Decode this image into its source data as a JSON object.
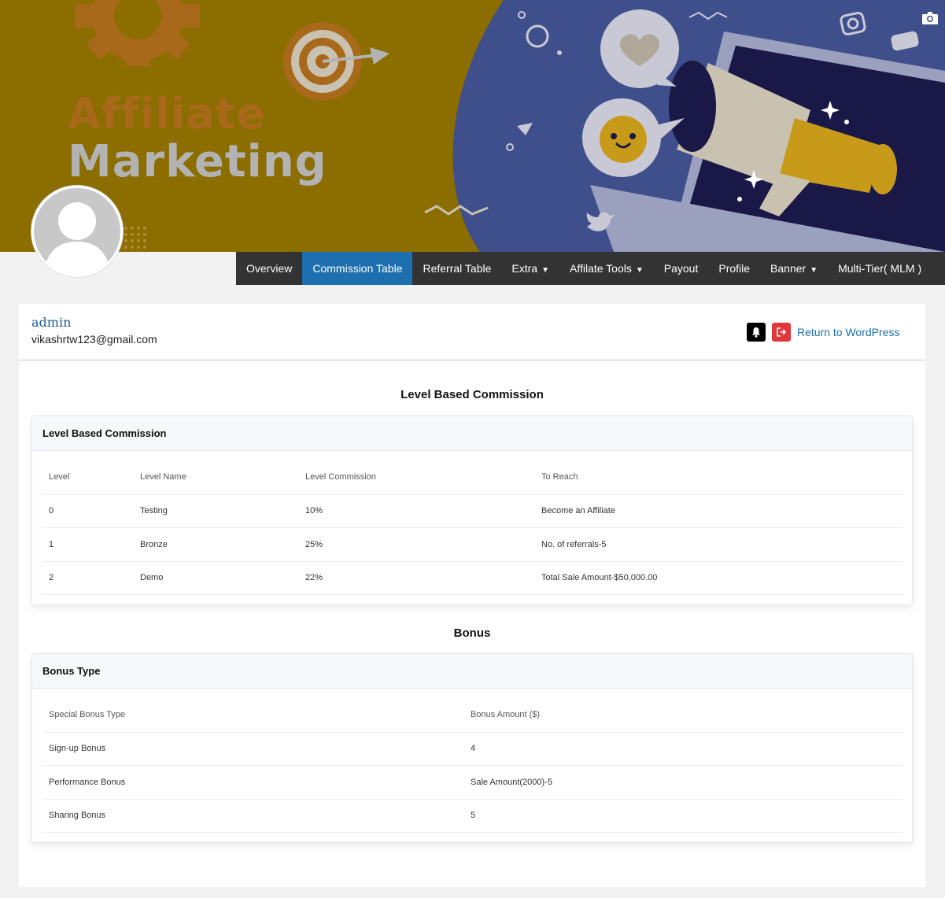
{
  "banner": {
    "line1": "Affiliate",
    "line2": "Marketing"
  },
  "nav": {
    "items": [
      {
        "label": "Overview",
        "active": false,
        "dropdown": false
      },
      {
        "label": "Commission Table",
        "active": true,
        "dropdown": false
      },
      {
        "label": "Referral Table",
        "active": false,
        "dropdown": false
      },
      {
        "label": "Extra",
        "active": false,
        "dropdown": true
      },
      {
        "label": "Affilate Tools",
        "active": false,
        "dropdown": true
      },
      {
        "label": "Payout",
        "active": false,
        "dropdown": false
      },
      {
        "label": "Profile",
        "active": false,
        "dropdown": false
      },
      {
        "label": "Banner",
        "active": false,
        "dropdown": true
      },
      {
        "label": "Multi-Tier( MLM )",
        "active": false,
        "dropdown": false
      }
    ],
    "caret": "▼"
  },
  "user": {
    "name": "admin",
    "email": "vikashrtw123@gmail.com",
    "return_label": "Return to WordPress"
  },
  "level_section": {
    "title": "Level Based Commission",
    "card_title": "Level Based Commission",
    "columns": [
      "Level",
      "Level Name",
      "Level Commission",
      "To Reach"
    ],
    "rows": [
      [
        "0",
        "Testing",
        "10%",
        "Become an Affiliate"
      ],
      [
        "1",
        "Bronze",
        "25%",
        "No. of referrals-5"
      ],
      [
        "2",
        "Demo",
        "22%",
        "Total Sale Amount-$50,000.00"
      ]
    ]
  },
  "bonus_section": {
    "title": "Bonus",
    "card_title": "Bonus Type",
    "columns": [
      "Special Bonus Type",
      "Bonus Amount ($)"
    ],
    "rows": [
      [
        "Sign-up Bonus",
        "4"
      ],
      [
        "Performance Bonus",
        "Sale Amount(2000)-5"
      ],
      [
        "Sharing Bonus",
        "5"
      ]
    ]
  },
  "colors": {
    "nav_bg": "#333333",
    "nav_active": "#1d6fb0",
    "link": "#1d6fb0",
    "logout": "#e0383a",
    "banner_left": "#8b6d00",
    "banner_right": "#3e4f8c"
  },
  "icons": [
    "camera-icon",
    "bell-icon",
    "logout-icon",
    "avatar-placeholder-icon",
    "gear-icon",
    "target-icon",
    "megaphone-icon",
    "heart-icon",
    "whatsapp-icon",
    "instagram-icon",
    "twitter-icon",
    "chat-icon"
  ]
}
